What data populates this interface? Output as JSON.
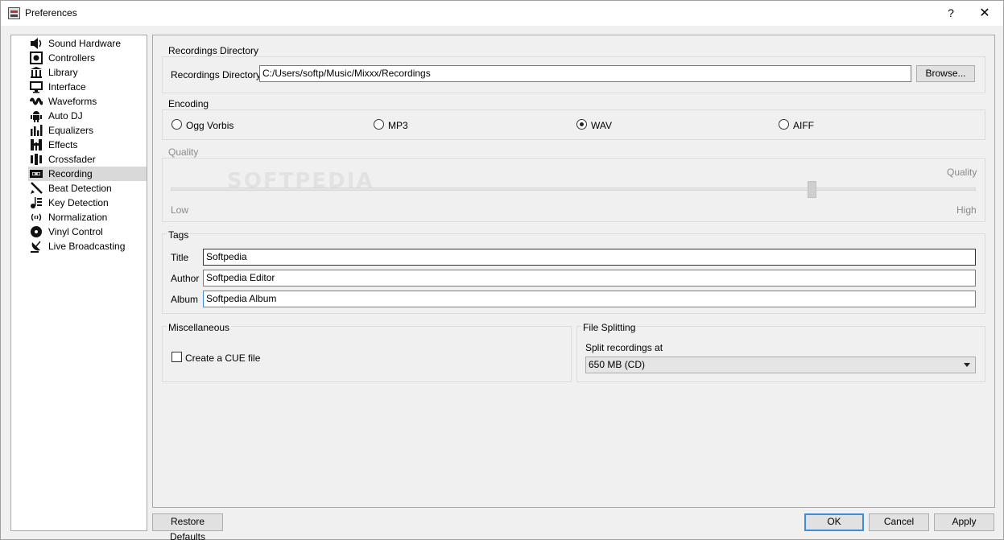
{
  "window": {
    "title": "Preferences",
    "help_glyph": "?",
    "close_glyph": "✕"
  },
  "watermark": "SOFTPEDIA",
  "sidebar": {
    "items": [
      {
        "label": "Sound Hardware",
        "icon": "speaker-icon"
      },
      {
        "label": "Controllers",
        "icon": "controller-icon"
      },
      {
        "label": "Library",
        "icon": "library-icon"
      },
      {
        "label": "Interface",
        "icon": "monitor-icon"
      },
      {
        "label": "Waveforms",
        "icon": "waveform-icon"
      },
      {
        "label": "Auto DJ",
        "icon": "robot-icon"
      },
      {
        "label": "Equalizers",
        "icon": "equalizer-icon"
      },
      {
        "label": "Effects",
        "icon": "effects-icon"
      },
      {
        "label": "Crossfader",
        "icon": "crossfader-icon"
      },
      {
        "label": "Recording",
        "icon": "cassette-icon"
      },
      {
        "label": "Beat Detection",
        "icon": "metronome-icon"
      },
      {
        "label": "Key Detection",
        "icon": "key-detection-icon"
      },
      {
        "label": "Normalization",
        "icon": "normalization-icon"
      },
      {
        "label": "Vinyl Control",
        "icon": "vinyl-icon"
      },
      {
        "label": "Live Broadcasting",
        "icon": "broadcast-icon"
      }
    ],
    "selected": "Recording"
  },
  "recordings_directory": {
    "group_title": "Recordings Directory",
    "label": "Recordings Directory:",
    "value": "C:/Users/softp/Music/Mixxx/Recordings",
    "browse_label": "Browse..."
  },
  "encoding": {
    "group_title": "Encoding",
    "options": [
      "Ogg Vorbis",
      "MP3",
      "WAV",
      "AIFF"
    ],
    "selected": "WAV"
  },
  "quality": {
    "group_title": "Quality",
    "value_label": "Quality",
    "low_label": "Low",
    "high_label": "High",
    "level": 0.8
  },
  "tags": {
    "group_title": "Tags",
    "title_label": "Title",
    "title_value": "Softpedia",
    "author_label": "Author",
    "author_value": "Softpedia Editor",
    "album_label": "Album",
    "album_value": "Softpedia Album"
  },
  "misc": {
    "group_title": "Miscellaneous",
    "cue_label": "Create a CUE file",
    "cue_checked": false
  },
  "file_splitting": {
    "group_title": "File Splitting",
    "label": "Split recordings at",
    "value": "650 MB (CD)"
  },
  "footer": {
    "restore_label": "Restore Defaults",
    "ok_label": "OK",
    "cancel_label": "Cancel",
    "apply_label": "Apply"
  }
}
